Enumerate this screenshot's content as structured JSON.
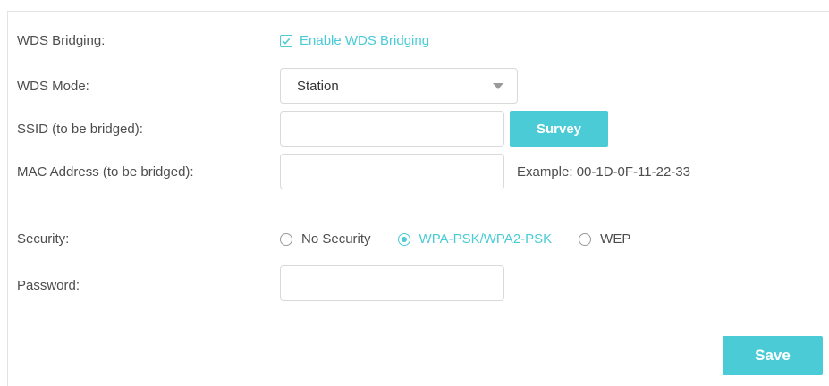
{
  "colors": {
    "accent": "#4acbd6",
    "text": "#4d4d4d",
    "border": "#d9d9d9"
  },
  "wds_bridging": {
    "label": "WDS Bridging:",
    "checkbox_label": "Enable WDS Bridging",
    "checked": true
  },
  "wds_mode": {
    "label": "WDS Mode:",
    "selected": "Station"
  },
  "ssid": {
    "label": "SSID (to be bridged):",
    "value": "",
    "survey_label": "Survey"
  },
  "mac": {
    "label": "MAC Address (to be bridged):",
    "value": "",
    "hint": "Example: 00-1D-0F-11-22-33"
  },
  "security": {
    "label": "Security:",
    "options": [
      {
        "label": "No Security",
        "checked": false
      },
      {
        "label": "WPA-PSK/WPA2-PSK",
        "checked": true
      },
      {
        "label": "WEP",
        "checked": false
      }
    ]
  },
  "password": {
    "label": "Password:",
    "value": ""
  },
  "actions": {
    "save_label": "Save"
  }
}
